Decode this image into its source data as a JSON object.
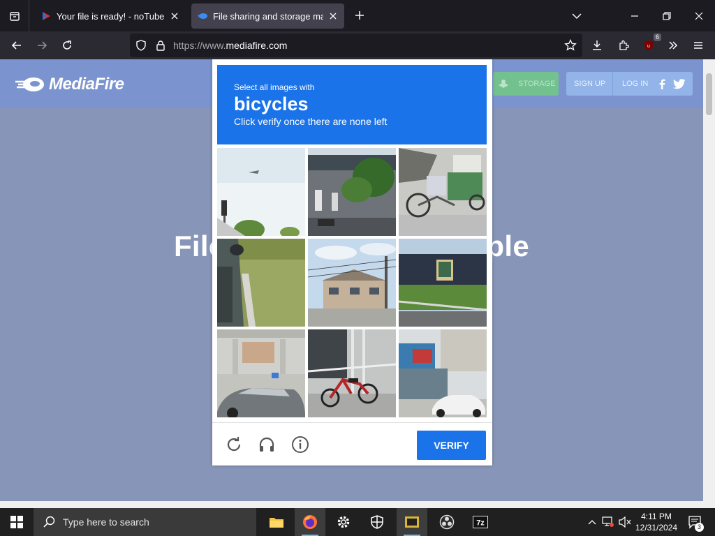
{
  "browser": {
    "tabs": [
      {
        "title": "Your file is ready! - noTube"
      },
      {
        "title": "File sharing and storage made si"
      }
    ],
    "url": {
      "scheme": "https://www.",
      "domain": "mediafire.com"
    },
    "extension_badge": "6"
  },
  "page": {
    "logo_text": "MediaFire",
    "storage_label": "STORAGE",
    "signup_label": "SIGN UP",
    "login_label": "LOG IN",
    "hero_text": "File storage made simple"
  },
  "captcha": {
    "instruction": "Select all images with",
    "target": "bicycles",
    "sub_instruction": "Click verify once there are none left",
    "verify_label": "VERIFY",
    "header_color": "#1a73e8",
    "tiles": [
      "plane-sky-traffic-light",
      "gas-station-trees",
      "cart-bicycle",
      "car-mirror-grass",
      "houses-power-lines",
      "building-billboard-road",
      "parking-car",
      "bicycle-fence",
      "storefront-car"
    ]
  },
  "taskbar": {
    "search_placeholder": "Type here to search",
    "time": "4:11 PM",
    "date": "12/31/2024",
    "notification_count": "3"
  }
}
